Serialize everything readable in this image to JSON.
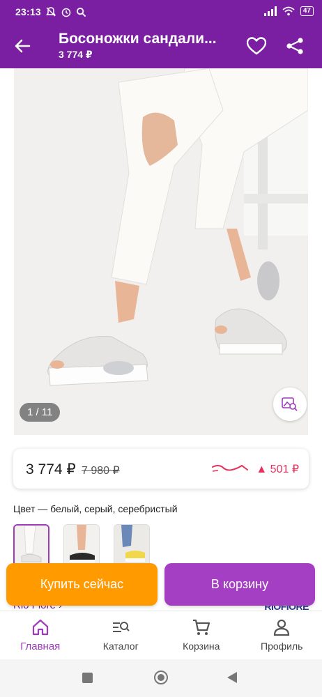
{
  "status_bar": {
    "time": "23:13",
    "battery": "47"
  },
  "app_bar": {
    "title": "Босоножки сандали...",
    "price": "3 774 ₽"
  },
  "gallery": {
    "counter": "1 / 11"
  },
  "price_card": {
    "current": "3 774 ₽",
    "old": "7 980 ₽",
    "diff": "▲ 501 ₽"
  },
  "color": {
    "label": "Цвет — белый, серый, серебристый"
  },
  "brand": {
    "name": "Rio Fiore ›",
    "logo_text": "RIOFIORE"
  },
  "actions": {
    "buy_now": "Купить сейчас",
    "add_to_cart": "В корзину"
  },
  "bottom_nav": {
    "items": [
      {
        "label": "Главная",
        "icon": "home-icon",
        "active": true
      },
      {
        "label": "Каталог",
        "icon": "catalog-search-icon",
        "active": false
      },
      {
        "label": "Корзина",
        "icon": "cart-icon",
        "active": false
      },
      {
        "label": "Профиль",
        "icon": "profile-icon",
        "active": false
      }
    ]
  },
  "colors": {
    "primary": "#7a1fa2",
    "accent": "#a43fc3",
    "buy": "#ff9a00",
    "price_up": "#e8305a"
  }
}
